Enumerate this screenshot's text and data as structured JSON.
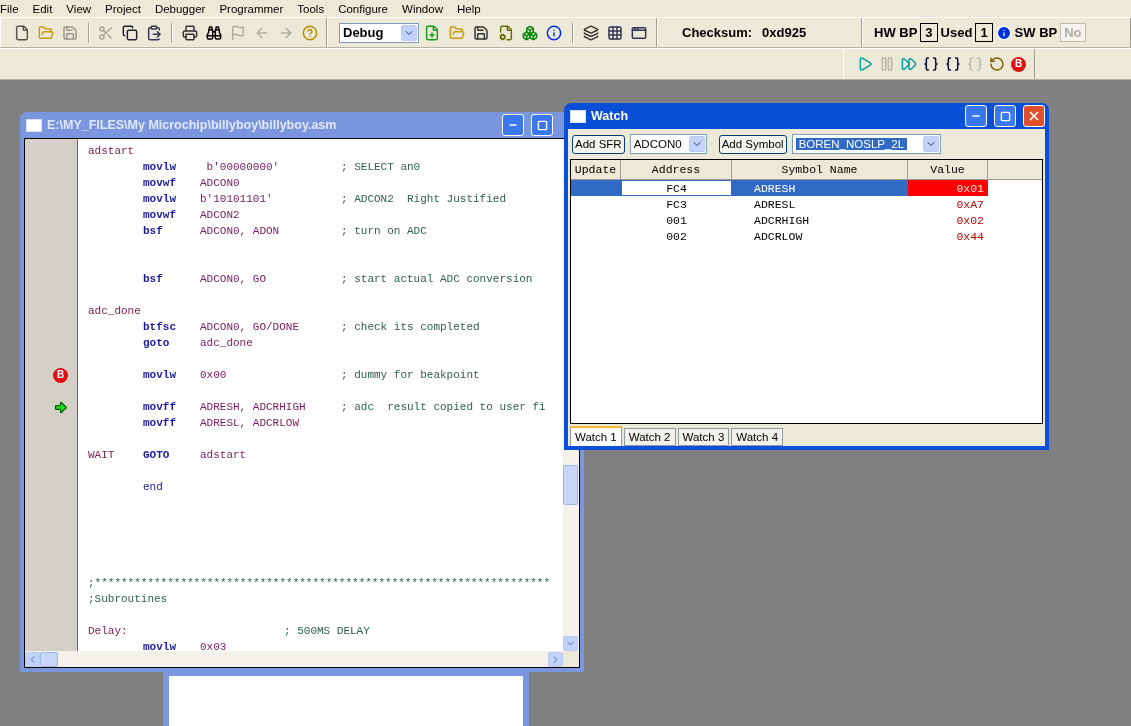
{
  "menu": [
    "File",
    "Edit",
    "View",
    "Project",
    "Debugger",
    "Programmer",
    "Tools",
    "Configure",
    "Window",
    "Help"
  ],
  "toolbar_main": [
    {
      "kind": "new",
      "disabled": false
    },
    {
      "kind": "open",
      "disabled": false
    },
    {
      "kind": "save",
      "disabled": true
    },
    {
      "kind": "sep"
    },
    {
      "kind": "cut",
      "disabled": true
    },
    {
      "kind": "copy",
      "disabled": false
    },
    {
      "kind": "paste",
      "disabled": false
    },
    {
      "kind": "sep"
    },
    {
      "kind": "print",
      "disabled": false
    },
    {
      "kind": "find",
      "disabled": false
    },
    {
      "kind": "flag",
      "disabled": true
    },
    {
      "kind": "back",
      "disabled": true
    },
    {
      "kind": "forward",
      "disabled": true
    },
    {
      "kind": "help",
      "disabled": false
    }
  ],
  "build_config": "Debug",
  "toolbar_project": [
    {
      "kind": "new-project",
      "disabled": false
    },
    {
      "kind": "open",
      "disabled": false
    },
    {
      "kind": "save",
      "disabled": false
    },
    {
      "kind": "build",
      "disabled": false
    },
    {
      "kind": "boxes",
      "disabled": false
    },
    {
      "kind": "info",
      "disabled": false
    },
    {
      "kind": "sep"
    },
    {
      "kind": "layers",
      "disabled": false
    },
    {
      "kind": "grid",
      "disabled": false
    },
    {
      "kind": "window",
      "disabled": false
    }
  ],
  "checksum": {
    "label": "Checksum:",
    "value": "0xd925"
  },
  "breakpoints": {
    "hw_label": "HW BP",
    "hw_count": "3",
    "used_label": "Used",
    "used_count": "1",
    "sw_label": "SW BP",
    "sw_value": "No",
    "sw_disabled": true
  },
  "debug_toolbar": [
    {
      "kind": "run",
      "disabled": false
    },
    {
      "kind": "halt",
      "disabled": true
    },
    {
      "kind": "animate",
      "disabled": false
    },
    {
      "kind": "step-into",
      "disabled": false
    },
    {
      "kind": "step-over",
      "disabled": false
    },
    {
      "kind": "step-out",
      "disabled": true
    },
    {
      "kind": "reset",
      "disabled": false
    },
    {
      "kind": "breakpoint",
      "disabled": false,
      "glyph": "B"
    }
  ],
  "editor": {
    "title": "E:\\MY_FILES\\My Microchip\\billyboy\\billyboy.asm",
    "active": false,
    "lines": [
      {
        "kind": "code",
        "label": "adstart"
      },
      {
        "kind": "code",
        "op": "movlw",
        "args": " b'00000000'",
        "comment": "; SELECT an0"
      },
      {
        "kind": "code",
        "op": "movwf",
        "args": "ADCON0"
      },
      {
        "kind": "code",
        "op": "movlw",
        "args": "b'10101101'",
        "comment": "; ADCON2  Right Justified"
      },
      {
        "kind": "code",
        "op": "movwf",
        "args": "ADCON2"
      },
      {
        "kind": "code",
        "op": "bsf",
        "args": "ADCON0, ADON",
        "comment": "; turn on ADC"
      },
      {
        "kind": "blank"
      },
      {
        "kind": "blank"
      },
      {
        "kind": "code",
        "op": "bsf",
        "args": "ADCON0, GO",
        "comment": "; start actual ADC conversion"
      },
      {
        "kind": "blank"
      },
      {
        "kind": "code",
        "label": "adc_done"
      },
      {
        "kind": "code",
        "op": "btfsc",
        "args": "ADCON0, GO/DONE",
        "comment": "; check its completed"
      },
      {
        "kind": "code",
        "op": "goto",
        "args": "adc_done"
      },
      {
        "kind": "blank"
      },
      {
        "kind": "code",
        "op": "movlw",
        "args": "0x00",
        "comment": "; dummy for beakpoint",
        "breakpoint": true,
        "marker_glyph": "B"
      },
      {
        "kind": "blank"
      },
      {
        "kind": "code",
        "op": "movff",
        "args": "ADRESH, ADCRHIGH",
        "comment": "; adc  result copied to user fi",
        "current": true
      },
      {
        "kind": "code",
        "op": "movff",
        "args": "ADRESL, ADCRLOW"
      },
      {
        "kind": "blank"
      },
      {
        "kind": "code",
        "label": "WAIT",
        "op": "GOTO",
        "args": "adstart"
      },
      {
        "kind": "blank"
      },
      {
        "kind": "directive",
        "text": "end"
      },
      {
        "kind": "blank"
      },
      {
        "kind": "blank"
      },
      {
        "kind": "blank"
      },
      {
        "kind": "blank"
      },
      {
        "kind": "blank"
      },
      {
        "kind": "comment",
        "text": ";*********************************************************************"
      },
      {
        "kind": "comment",
        "text": ";Subroutines"
      },
      {
        "kind": "blank"
      },
      {
        "kind": "code",
        "label": "Delay:",
        "comment": "; 500MS DELAY"
      },
      {
        "kind": "code",
        "op": "movlw",
        "args": "0x03"
      }
    ]
  },
  "watch": {
    "title": "Watch",
    "active": true,
    "add_sfr": "Add SFR",
    "sfr_select": "ADCON0",
    "add_symbol": "Add Symbol",
    "symbol_select": "BOREN_NOSLP_2L",
    "columns": [
      "Update",
      "Address",
      "Symbol Name",
      "Value"
    ],
    "rows": [
      {
        "address": "FC4",
        "symbol": "ADRESH",
        "value": "0x01",
        "selected": true
      },
      {
        "address": "FC3",
        "symbol": "ADRESL",
        "value": "0xA7",
        "selected": false
      },
      {
        "address": "001",
        "symbol": "ADCRHIGH",
        "value": "0x02",
        "selected": false
      },
      {
        "address": "002",
        "symbol": "ADCRLOW",
        "value": "0x44",
        "selected": false
      }
    ],
    "tabs": [
      {
        "label": "Watch 1",
        "selected": true
      },
      {
        "label": "Watch 2",
        "selected": false
      },
      {
        "label": "Watch 3",
        "selected": false
      },
      {
        "label": "Watch 4",
        "selected": false
      }
    ]
  }
}
